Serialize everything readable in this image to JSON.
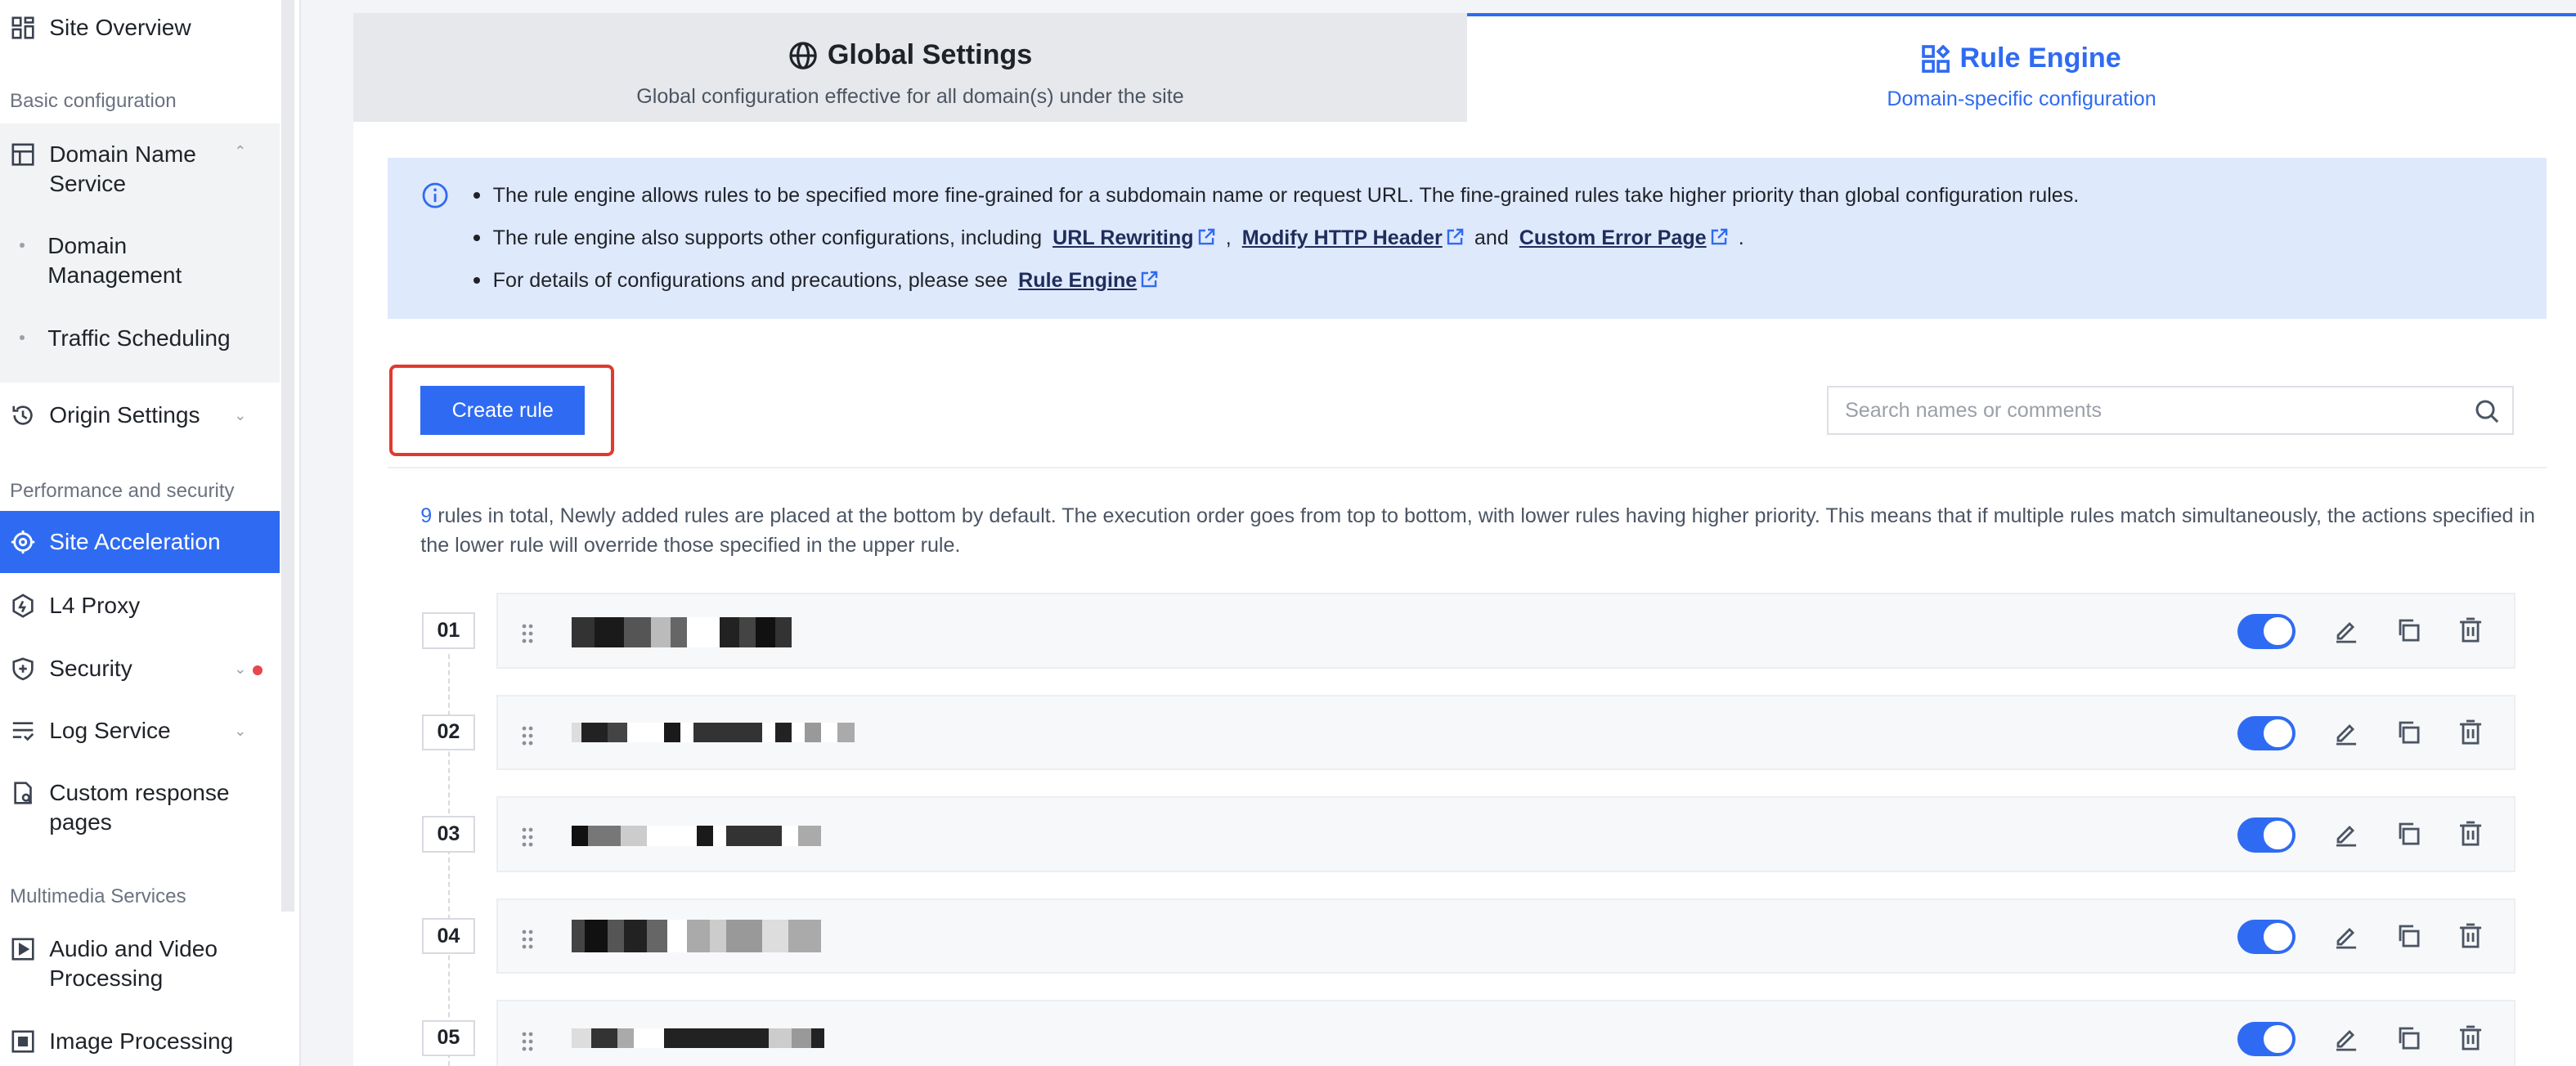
{
  "sidebar": {
    "top_item": "Site Overview",
    "groups": {
      "basic": "Basic configuration",
      "perf": "Performance and security",
      "media": "Multimedia Services"
    },
    "items": {
      "dns": "Domain Name Service",
      "domain_mgmt": "Domain Management",
      "traffic": "Traffic Scheduling",
      "origin": "Origin Settings",
      "accel": "Site Acceleration",
      "l4": "L4 Proxy",
      "security": "Security",
      "log": "Log Service",
      "custom_pages": "Custom response pages",
      "av": "Audio and Video Processing",
      "image": "Image Processing"
    }
  },
  "tabs": {
    "global": {
      "title": "Global Settings",
      "subtitle": "Global configuration effective for all domain(s) under the site"
    },
    "rule": {
      "title": "Rule Engine",
      "subtitle": "Domain-specific configuration"
    }
  },
  "notice": {
    "line1": "The rule engine allows rules to be specified more fine-grained for a subdomain name or request URL. The fine-grained rules take higher priority than global configuration rules.",
    "line2_prefix": "The rule engine also supports other configurations, including",
    "link_url_rewriting": "URL Rewriting",
    "sep_comma": ",",
    "link_modify_header": "Modify HTTP Header",
    "sep_and": "and",
    "link_error_page": "Custom Error Page",
    "sep_period": ".",
    "line3_prefix": "For details of configurations and precautions, please see",
    "link_rule_engine": "Rule Engine"
  },
  "toolbar": {
    "create_label": "Create rule",
    "search_placeholder": "Search names or comments"
  },
  "summary": {
    "count": "9",
    "text": "rules in total, Newly added rules are placed at the bottom by default. The execution order goes from top to bottom, with lower rules having higher priority. This means that if multiple rules match simultaneously, the actions specified in the lower rule will override those specified in the upper rule."
  },
  "rules": [
    {
      "num": "01",
      "enabled": true
    },
    {
      "num": "02",
      "enabled": true
    },
    {
      "num": "03",
      "enabled": true
    },
    {
      "num": "04",
      "enabled": true
    },
    {
      "num": "05",
      "enabled": true
    }
  ],
  "colors": {
    "accent": "#2f6bf2",
    "highlight": "#e03a2f",
    "notice_bg": "#dfe9fc"
  }
}
